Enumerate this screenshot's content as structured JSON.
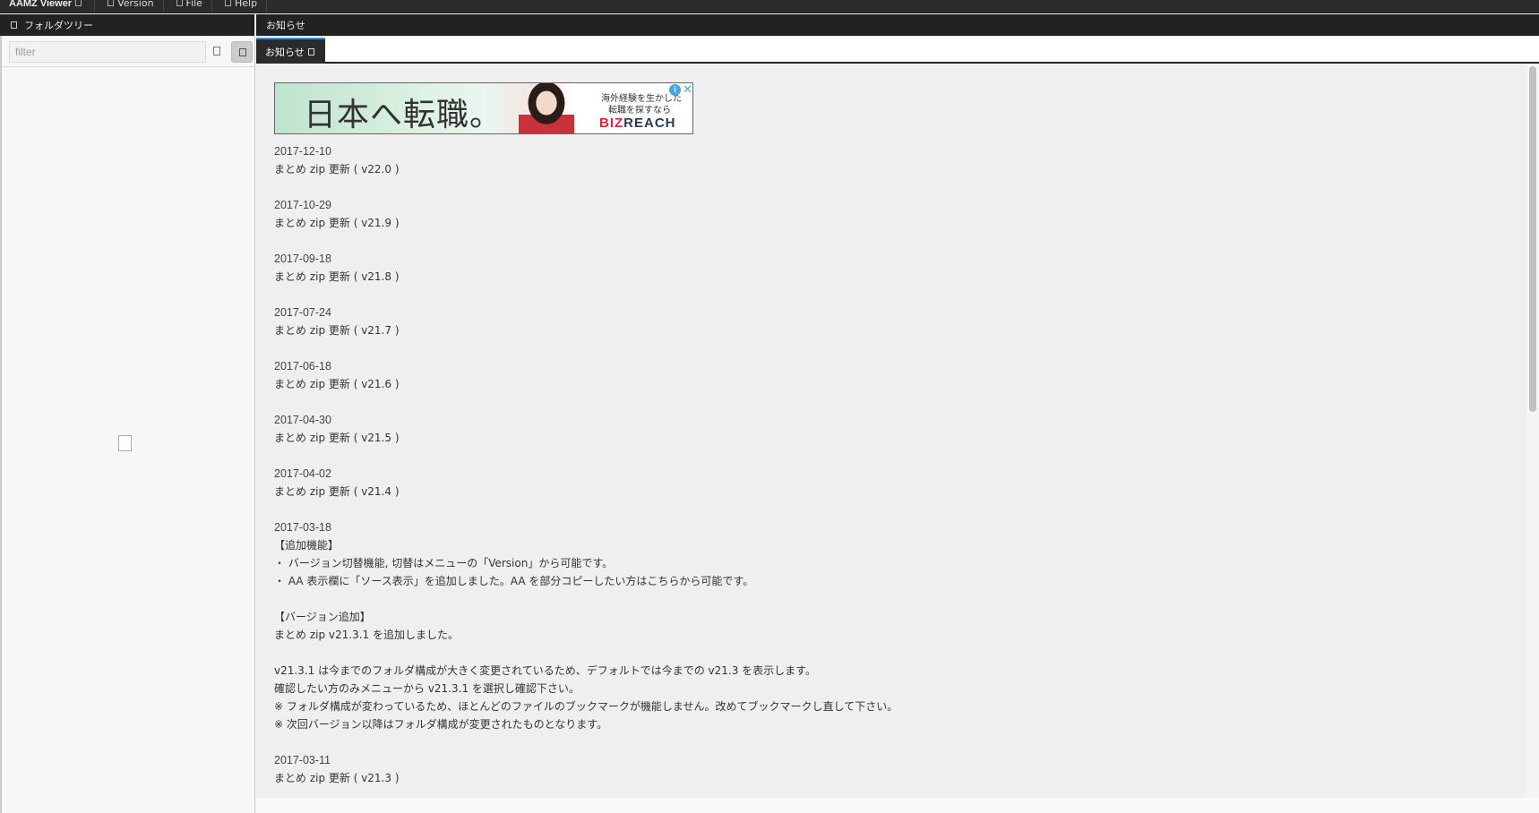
{
  "menubar": {
    "app_title": "AAMZ Viewer",
    "items": [
      {
        "label": "Version"
      },
      {
        "label": "File"
      },
      {
        "label": "Help"
      }
    ]
  },
  "left_panel": {
    "header": "フォルダツリー",
    "filter": {
      "value": "",
      "placeholder": "filter"
    }
  },
  "main": {
    "header": "お知らせ",
    "tab_label": "お知らせ"
  },
  "ad": {
    "headline": "日本へ転職。",
    "copy_line1": "海外経験を生かした",
    "copy_line2": "転職を探すなら",
    "brand_part1": "BIZ",
    "brand_part2": "REACH",
    "info_icon": "info-icon",
    "close_icon": "close-icon"
  },
  "notices": [
    {
      "lines": [
        "2017-12-10",
        "まとめ zip 更新 ( v22.0 )"
      ]
    },
    {
      "lines": [
        "2017-10-29",
        "まとめ zip 更新 ( v21.9 )"
      ]
    },
    {
      "lines": [
        "2017-09-18",
        "まとめ zip 更新 ( v21.8 )"
      ]
    },
    {
      "lines": [
        "2017-07-24",
        "まとめ zip 更新 ( v21.7 )"
      ]
    },
    {
      "lines": [
        "2017-06-18",
        "まとめ zip 更新 ( v21.6 )"
      ]
    },
    {
      "lines": [
        "2017-04-30",
        "まとめ zip 更新 ( v21.5 )"
      ]
    },
    {
      "lines": [
        "2017-04-02",
        "まとめ zip 更新 ( v21.4 )"
      ]
    },
    {
      "lines": [
        "2017-03-18",
        "【追加機能】",
        "・ バージョン切替機能, 切替はメニューの「Version」から可能です。",
        "・ AA 表示欄に「ソース表示」を追加しました。AA を部分コピーしたい方はこちらから可能です。",
        "",
        "【バージョン追加】",
        "まとめ zip v21.3.1 を追加しました。",
        "",
        "v21.3.1 は今までのフォルダ構成が大きく変更されているため、デフォルトでは今までの v21.3 を表示します。",
        "確認したい方のみメニューから v21.3.1 を選択し確認下さい。",
        "※ フォルダ構成が変わっているため、ほとんどのファイルのブックマークが機能しません。改めてブックマークし直して下さい。",
        "※ 次回バージョン以降はフォルダ構成が変更されたものとなります。"
      ]
    },
    {
      "lines": [
        "2017-03-11",
        "まとめ zip 更新 ( v21.3 )"
      ]
    }
  ]
}
